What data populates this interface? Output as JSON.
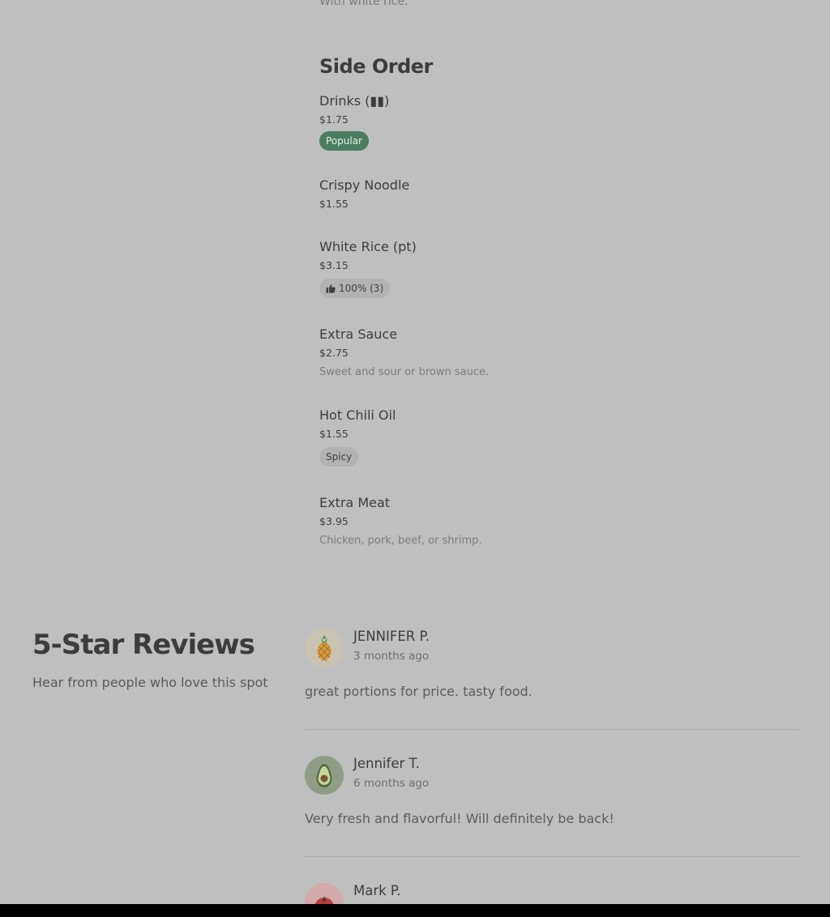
{
  "clipped_description": "With white rice.",
  "side_order": {
    "title": "Side Order",
    "items": [
      {
        "name": "Drinks (▮▮)",
        "price": "$1.75",
        "badge": "Popular",
        "badge_type": "popular"
      },
      {
        "name": "Crispy Noodle",
        "price": "$1.55"
      },
      {
        "name": "White Rice (pt)",
        "price": "$3.15",
        "badge": "100% (3)",
        "badge_type": "rating",
        "badge_icon": "thumbs-up-icon"
      },
      {
        "name": "Extra Sauce",
        "price": "$2.75",
        "description": "Sweet and sour or brown sauce."
      },
      {
        "name": "Hot Chili Oil",
        "price": "$1.55",
        "badge": "Spicy",
        "badge_type": "grey"
      },
      {
        "name": "Extra Meat",
        "price": "$3.95",
        "description": "Chicken, pork, beef, or shrimp."
      }
    ]
  },
  "reviews": {
    "title": "5-Star Reviews",
    "subtitle": "Hear from people who love this spot",
    "items": [
      {
        "name": "JENNIFER P.",
        "date": "3 months ago",
        "text": "great portions for price. tasty food.",
        "avatar_icon": "pineapple-icon",
        "avatar_color": "#c9c3b1"
      },
      {
        "name": "Jennifer T.",
        "date": "6 months ago",
        "text": "Very fresh and flavorful! Will definitely be back!",
        "avatar_icon": "avocado-icon",
        "avatar_color": "#8f9d86"
      },
      {
        "name": "Mark P.",
        "avatar_icon": "tomato-icon",
        "avatar_color": "#d4a9a9"
      }
    ]
  },
  "colors": {
    "background": "#bfbfbf",
    "popular_badge": "#4a7d61",
    "grey_badge": "#b2b2b2"
  }
}
